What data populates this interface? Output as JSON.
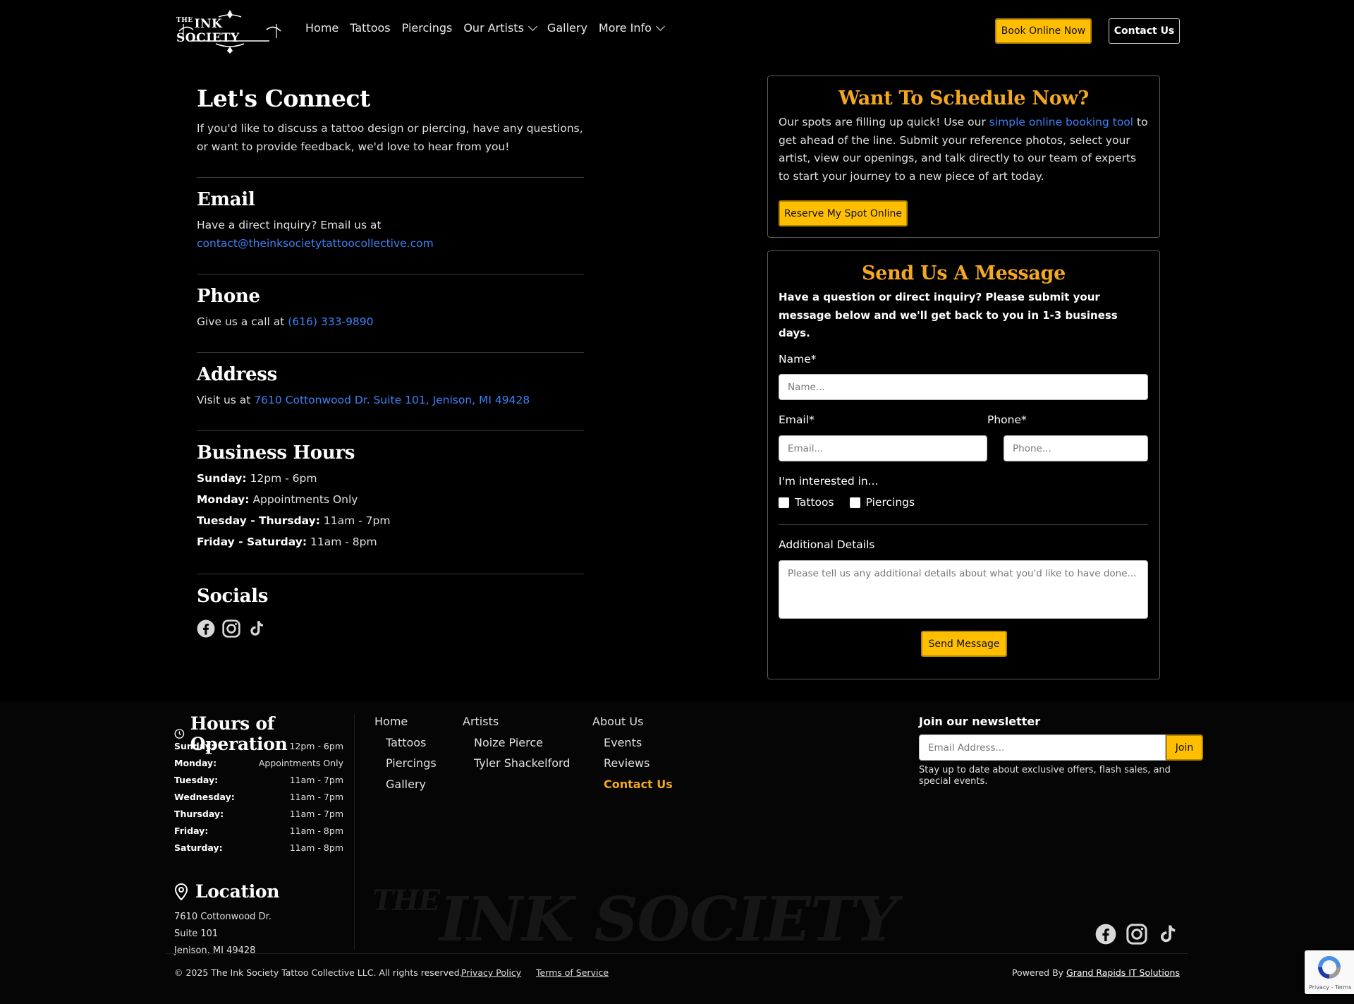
{
  "header": {
    "logo_prefix": "THE",
    "logo_text": "INK SOCIETY",
    "nav": [
      {
        "label": "Home"
      },
      {
        "label": "Tattoos"
      },
      {
        "label": "Piercings"
      },
      {
        "label": "Our Artists"
      },
      {
        "label": "Gallery"
      },
      {
        "label": "More Info"
      }
    ],
    "book_button": "Book Online Now",
    "contact_button": "Contact Us"
  },
  "connect": {
    "title": "Let's Connect",
    "intro": "If you'd like to discuss a tattoo design or piercing, have any questions, or want to provide feedback, we'd love to hear from you!"
  },
  "email": {
    "heading": "Email",
    "text": "Have a direct inquiry? Email us at",
    "address": "contact@theinksocietytattoocollective.com"
  },
  "phone": {
    "heading": "Phone",
    "text": "Give us a call at",
    "number": "(616) 333-9890"
  },
  "address": {
    "heading": "Address",
    "text": "Visit us at",
    "value": "7610 Cottonwood Dr. Suite 101, Jenison, MI 49428"
  },
  "business_hours": {
    "heading": "Business Hours",
    "rows": [
      {
        "day": "Sunday:",
        "hours": "12pm - 6pm"
      },
      {
        "day": "Monday:",
        "hours": "Appointments Only"
      },
      {
        "day": "Tuesday - Thursday:",
        "hours": "11am - 7pm"
      },
      {
        "day": "Friday - Saturday:",
        "hours": "11am - 8pm"
      }
    ]
  },
  "socials": {
    "heading": "Socials",
    "icons": [
      "facebook-icon",
      "instagram-icon",
      "tiktok-icon"
    ]
  },
  "schedule_card": {
    "title": "Want To Schedule Now?",
    "text_before": "Our spots are filling up quick! Use our",
    "link": "simple online booking tool",
    "text_after": "to get ahead of the line. Submit your reference photos, select your artist, view our openings, and talk directly to our team of experts to start your journey to a new piece of art today.",
    "button": "Reserve My Spot Online"
  },
  "message_card": {
    "title": "Send Us A Message",
    "intro": "Have a question or direct inquiry? Please submit your message below and we'll get back to you in 1-3 business days.",
    "name_label": "Name*",
    "name_placeholder": "Name...",
    "email_label": "Email*",
    "email_placeholder": "Email...",
    "phone_label": "Phone*",
    "phone_placeholder": "Phone...",
    "interest_label": "I'm interested in...",
    "interest_options": [
      "Tattoos",
      "Piercings"
    ],
    "details_label": "Additional Details",
    "details_placeholder": "Please tell us any additional details about what you'd like to have done...",
    "send_button": "Send Message"
  },
  "footer": {
    "hours_heading": "Hours of Operation",
    "hours": [
      {
        "day": "Sunday:",
        "hours": "12pm - 6pm"
      },
      {
        "day": "Monday:",
        "hours": "Appointments Only"
      },
      {
        "day": "Tuesday:",
        "hours": "11am - 7pm"
      },
      {
        "day": "Wednesday:",
        "hours": "11am - 7pm"
      },
      {
        "day": "Thursday:",
        "hours": "11am - 7pm"
      },
      {
        "day": "Friday:",
        "hours": "11am - 8pm"
      },
      {
        "day": "Saturday:",
        "hours": "11am - 8pm"
      }
    ],
    "location_heading": "Location",
    "location_lines": [
      "7610 Cottonwood Dr.",
      "Suite 101",
      "Jenison, MI 49428"
    ],
    "col1": {
      "head": "Home",
      "items": [
        "Tattoos",
        "Piercings",
        "Gallery"
      ]
    },
    "col2": {
      "head": "Artists",
      "items": [
        "Noize Pierce",
        "Tyler Shackelford"
      ]
    },
    "col3": {
      "head": "About Us",
      "items": [
        "Events",
        "Reviews",
        "Contact Us"
      ]
    },
    "newsletter_heading": "Join our newsletter",
    "newsletter_placeholder": "Email Address...",
    "newsletter_button": "Join",
    "newsletter_note": "Stay up to date about exclusive offers, flash sales, and special events.",
    "watermark_prefix": "THE",
    "watermark_text": "INK SOCIETY",
    "copyright": "© 2025 The Ink Society Tattoo Collective LLC. All rights reserved.",
    "privacy": "Privacy Policy",
    "terms": "Terms of Service",
    "powered_prefix": "Powered By",
    "powered_link": "Grand Rapids IT Solutions",
    "recaptcha_text": "Privacy - Terms"
  },
  "colors": {
    "accent": "#ffbf00",
    "heading_orange": "#f4a81d",
    "link_blue": "#3b82f6",
    "background": "#000000"
  }
}
